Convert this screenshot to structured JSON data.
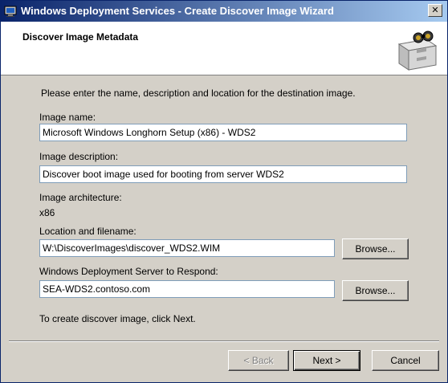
{
  "window": {
    "title": "Windows Deployment Services - Create Discover Image Wizard",
    "close_label": "✕"
  },
  "header": {
    "title": "Discover Image Metadata",
    "icon": "filing-cabinet-binoculars-icon"
  },
  "form": {
    "instruction": "Please enter the name, description and location for the destination image.",
    "image_name_label": "Image name:",
    "image_name_value": "Microsoft Windows Longhorn Setup (x86) - WDS2",
    "image_description_label": "Image description:",
    "image_description_value": "Discover boot image used for booting from server WDS2",
    "image_architecture_label": "Image architecture:",
    "image_architecture_value": "x86",
    "location_label": "Location and filename:",
    "location_value": "W:\\DiscoverImages\\discover_WDS2.WIM",
    "browse_location_label": "Browse...",
    "server_label": "Windows Deployment Server to Respond:",
    "server_value": "SEA-WDS2.contoso.com",
    "browse_server_label": "Browse...",
    "footer_hint": "To create discover image, click Next."
  },
  "buttons": {
    "back": "< Back",
    "next": "Next >",
    "cancel": "Cancel"
  }
}
